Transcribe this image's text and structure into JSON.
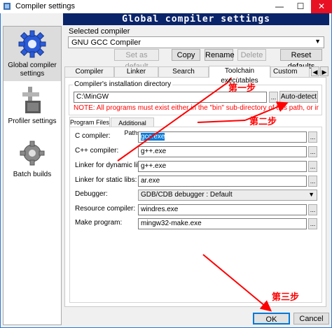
{
  "window": {
    "title": "Compiler settings",
    "banner": "Global compiler settings"
  },
  "sidebar": {
    "items": [
      {
        "label": "Global compiler settings",
        "icon": "gear-icon"
      },
      {
        "label": "Profiler settings",
        "icon": "profiler-icon"
      },
      {
        "label": "Batch builds",
        "icon": "batch-gear-icon"
      }
    ]
  },
  "compiler": {
    "selected_label": "Selected compiler",
    "selected_value": "GNU GCC Compiler",
    "buttons": [
      "Set as default",
      "Copy",
      "Rename",
      "Delete",
      "Reset defaults"
    ]
  },
  "tabs": [
    "Compiler settings",
    "Linker settings",
    "Search directories",
    "Toolchain executables",
    "Custom variab"
  ],
  "toolchain": {
    "install_label": "Compiler's installation directory",
    "install_value": "C:\\MinGW",
    "browse": "...",
    "autodetect": "Auto-detect",
    "note": "NOTE: All programs must exist either in the \"bin\" sub-directory of this path, or in any of the",
    "subtabs": [
      "Program Files",
      "Additional Paths"
    ],
    "rows": [
      {
        "label": "C compiler:",
        "value": "gcc.exe"
      },
      {
        "label": "C++ compiler:",
        "value": "g++.exe"
      },
      {
        "label": "Linker for dynamic libs:",
        "value": "g++.exe"
      },
      {
        "label": "Linker for static libs:",
        "value": "ar.exe"
      },
      {
        "label": "Debugger:",
        "value": "GDB/CDB debugger : Default"
      },
      {
        "label": "Resource compiler:",
        "value": "windres.exe"
      },
      {
        "label": "Make program:",
        "value": "mingw32-make.exe"
      }
    ]
  },
  "footer": {
    "ok": "OK",
    "cancel": "Cancel"
  },
  "annotations": {
    "step1": "第一步",
    "step2": "第二步",
    "step3": "第三步",
    "color": "#ff0000"
  }
}
